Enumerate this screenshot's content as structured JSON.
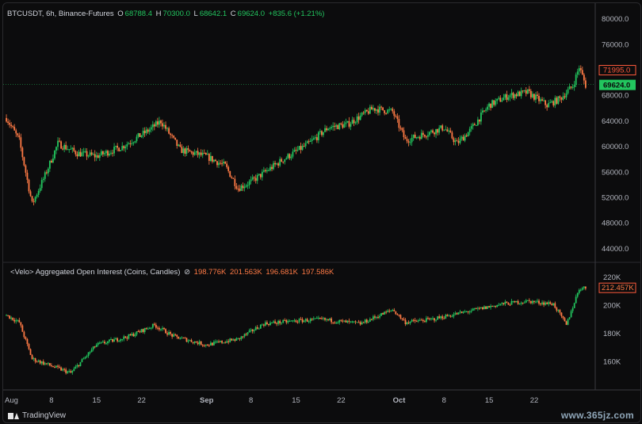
{
  "price_legend": {
    "symbol": "BTCUSDT, 6h, Binance-Futures",
    "o_label": "O",
    "o_value": "68788.4",
    "h_label": "H",
    "h_value": "70300.0",
    "l_label": "L",
    "l_value": "68642.1",
    "c_label": "C",
    "c_value": "69624.0",
    "change": "+835.6 (+1.21%)"
  },
  "oi_legend": {
    "title": "<Velo> Aggregated Open Interest (Coins, Candles)",
    "icon": "eye-slash-icon",
    "values": [
      "198.776K",
      "201.563K",
      "196.681K",
      "197.586K"
    ]
  },
  "price_axis": {
    "ticks": [
      "80000.0",
      "76000.0",
      "72000.0",
      "68000.0",
      "64000.0",
      "60000.0",
      "56000.0",
      "52000.0",
      "48000.0",
      "44000.0"
    ],
    "tag_high": "71995.0",
    "tag_last": "69624.0"
  },
  "oi_axis": {
    "ticks": [
      "220K",
      "200K",
      "180K",
      "160K"
    ],
    "tag_last": "212.457K"
  },
  "time_axis": [
    "Aug",
    "8",
    "15",
    "22",
    "Sep",
    "8",
    "15",
    "22",
    "Oct",
    "8",
    "15",
    "22"
  ],
  "footer": {
    "brand": "TradingView",
    "logo": "tradingview-logo-icon"
  },
  "watermark": "www.365jz.com",
  "colors": {
    "up": "#22c55e",
    "down": "#ff7a45",
    "background": "#0c0c0d",
    "last_tag": "#22c55e",
    "high_tag": "#ff5a3c"
  },
  "chart_data": [
    {
      "type": "candlestick",
      "title": "BTCUSDT, 6h, Binance-Futures",
      "ylim": [
        42000,
        82000
      ],
      "x_range": [
        "2024-08-01",
        "2024-10-30"
      ],
      "approx_close_path": [
        {
          "x": "2024-08-01",
          "y": 64500
        },
        {
          "x": "2024-08-03",
          "y": 61000
        },
        {
          "x": "2024-08-05",
          "y": 51000
        },
        {
          "x": "2024-08-07",
          "y": 55500
        },
        {
          "x": "2024-08-09",
          "y": 60500
        },
        {
          "x": "2024-08-12",
          "y": 59000
        },
        {
          "x": "2024-08-15",
          "y": 58500
        },
        {
          "x": "2024-08-19",
          "y": 60000
        },
        {
          "x": "2024-08-23",
          "y": 62500
        },
        {
          "x": "2024-08-25",
          "y": 64000
        },
        {
          "x": "2024-08-28",
          "y": 59500
        },
        {
          "x": "2024-09-01",
          "y": 58500
        },
        {
          "x": "2024-09-04",
          "y": 57000
        },
        {
          "x": "2024-09-06",
          "y": 53500
        },
        {
          "x": "2024-09-08",
          "y": 54500
        },
        {
          "x": "2024-09-13",
          "y": 58000
        },
        {
          "x": "2024-09-17",
          "y": 60500
        },
        {
          "x": "2024-09-20",
          "y": 63000
        },
        {
          "x": "2024-09-23",
          "y": 63500
        },
        {
          "x": "2024-09-27",
          "y": 66000
        },
        {
          "x": "2024-09-30",
          "y": 65500
        },
        {
          "x": "2024-10-02",
          "y": 61000
        },
        {
          "x": "2024-10-05",
          "y": 62000
        },
        {
          "x": "2024-10-08",
          "y": 63000
        },
        {
          "x": "2024-10-10",
          "y": 60500
        },
        {
          "x": "2024-10-12",
          "y": 62500
        },
        {
          "x": "2024-10-15",
          "y": 66500
        },
        {
          "x": "2024-10-18",
          "y": 68000
        },
        {
          "x": "2024-10-21",
          "y": 68500
        },
        {
          "x": "2024-10-24",
          "y": 66500
        },
        {
          "x": "2024-10-26",
          "y": 67500
        },
        {
          "x": "2024-10-28",
          "y": 69500
        },
        {
          "x": "2024-10-29",
          "y": 72500
        },
        {
          "x": "2024-10-30",
          "y": 69624
        }
      ]
    },
    {
      "type": "candlestick",
      "title": "<Velo> Aggregated Open Interest (Coins, Candles)",
      "ylim": [
        140000,
        230000
      ],
      "x_range": [
        "2024-08-01",
        "2024-10-30"
      ],
      "approx_close_path": [
        {
          "x": "2024-08-01",
          "y": 193000
        },
        {
          "x": "2024-08-03",
          "y": 188000
        },
        {
          "x": "2024-08-05",
          "y": 162000
        },
        {
          "x": "2024-08-08",
          "y": 157000
        },
        {
          "x": "2024-08-11",
          "y": 152000
        },
        {
          "x": "2024-08-15",
          "y": 172000
        },
        {
          "x": "2024-08-20",
          "y": 178000
        },
        {
          "x": "2024-08-24",
          "y": 186000
        },
        {
          "x": "2024-08-27",
          "y": 178000
        },
        {
          "x": "2024-09-01",
          "y": 172000
        },
        {
          "x": "2024-09-06",
          "y": 176000
        },
        {
          "x": "2024-09-10",
          "y": 187000
        },
        {
          "x": "2024-09-15",
          "y": 189000
        },
        {
          "x": "2024-09-19",
          "y": 190000
        },
        {
          "x": "2024-09-25",
          "y": 187000
        },
        {
          "x": "2024-09-30",
          "y": 197000
        },
        {
          "x": "2024-10-02",
          "y": 188000
        },
        {
          "x": "2024-10-06",
          "y": 190000
        },
        {
          "x": "2024-10-10",
          "y": 194000
        },
        {
          "x": "2024-10-14",
          "y": 198000
        },
        {
          "x": "2024-10-17",
          "y": 201000
        },
        {
          "x": "2024-10-21",
          "y": 203000
        },
        {
          "x": "2024-10-25",
          "y": 201000
        },
        {
          "x": "2024-10-27",
          "y": 186000
        },
        {
          "x": "2024-10-29",
          "y": 212000
        },
        {
          "x": "2024-10-30",
          "y": 212457
        }
      ]
    }
  ]
}
